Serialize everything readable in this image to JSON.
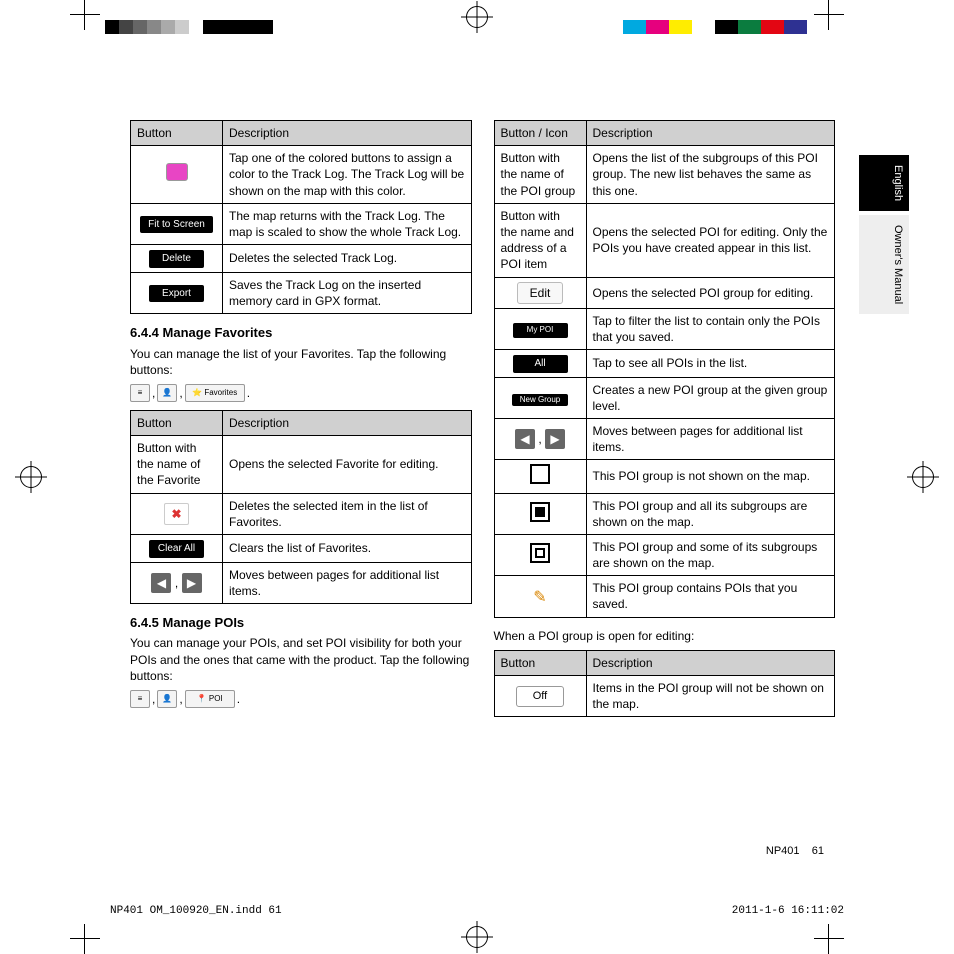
{
  "side_tabs": {
    "english": "English",
    "manual": "Owner's\nManual"
  },
  "left_col": {
    "table1": {
      "head": [
        "Button",
        "Description"
      ],
      "rows": [
        {
          "btn": "swatch",
          "desc": "Tap one of the colored buttons to assign a color to the Track Log. The Track Log will be shown on the map with this color."
        },
        {
          "btn": "Fit to Screen",
          "desc": "The map returns with the Track Log. The map is scaled to show the whole Track Log."
        },
        {
          "btn": "Delete",
          "desc": "Deletes the selected Track Log."
        },
        {
          "btn": "Export",
          "desc": "Saves the Track Log on the inserted memory card in GPX format."
        }
      ]
    },
    "sec_644": "6.4.4 Manage Favorites",
    "p_644": "You can manage the list of your Favorites. Tap the following buttons:",
    "icons_644": [
      {
        "g": "≡",
        "l": "Menu"
      },
      {
        "g": "👤",
        "l": "Manage"
      },
      {
        "g": "⭐ Favorites",
        "l": ""
      }
    ],
    "table2": {
      "head": [
        "Button",
        "Description"
      ],
      "rows": [
        {
          "btn_text": "Button with the name of the Favorite",
          "desc": "Opens the selected Favorite for editing."
        },
        {
          "btn": "x-red",
          "desc": "Deletes the selected item in the list of Favorites."
        },
        {
          "btn": "Clear All",
          "desc": "Clears the list of Favorites."
        },
        {
          "btn": "arrows",
          "desc": "Moves between pages for additional list items."
        }
      ]
    },
    "sec_645": "6.4.5 Manage POIs",
    "p_645": "You can manage your POIs, and set POI visibility for both your POIs and the ones that came with the product. Tap the following buttons:",
    "icons_645": [
      {
        "g": "≡",
        "l": "Menu"
      },
      {
        "g": "👤",
        "l": "Manage"
      },
      {
        "g": "📍 POI",
        "l": ""
      }
    ]
  },
  "right_col": {
    "table3": {
      "head": [
        "Button / Icon",
        "Description"
      ],
      "rows": [
        {
          "btn_text": "Button with the name of the POI group",
          "desc": "Opens the list of the subgroups of this POI group. The new list behaves the same as this one."
        },
        {
          "btn_text": "Button with the name and address of a POI item",
          "desc": "Opens the selected POI for editing. Only the POIs you have created appear in this list."
        },
        {
          "btn": "edit",
          "label": "Edit",
          "desc": "Opens the selected POI group for editing."
        },
        {
          "btn": "black",
          "label": "My POI",
          "desc": "Tap to filter the list to contain only the POIs that you saved."
        },
        {
          "btn": "black",
          "label": "All",
          "desc": "Tap to see all POIs in the list."
        },
        {
          "btn": "black",
          "label": "New Group",
          "desc": "Creates a new POI group at the given group level."
        },
        {
          "btn": "arrows",
          "desc": "Moves between pages for additional list items."
        },
        {
          "btn": "sq",
          "desc": "This POI group is not shown on the map."
        },
        {
          "btn": "sq-fill",
          "desc": "This POI group and all its subgroups are shown on the map."
        },
        {
          "btn": "sq-inner",
          "desc": "This POI group and some of its subgroups are shown on the map."
        },
        {
          "btn": "pencil",
          "desc": "This POI group contains POIs that you saved."
        }
      ]
    },
    "p_after": "When a POI group is open for editing:",
    "table4": {
      "head": [
        "Button",
        "Description"
      ],
      "rows": [
        {
          "btn": "white",
          "label": "Off",
          "desc": "Items in the POI group will not be shown on the map."
        }
      ]
    }
  },
  "footer": {
    "model": "NP401",
    "page": "61"
  },
  "print_footer": {
    "file": "NP401 OM_100920_EN.indd   61",
    "stamp": "2011-1-6   16:11:02"
  }
}
